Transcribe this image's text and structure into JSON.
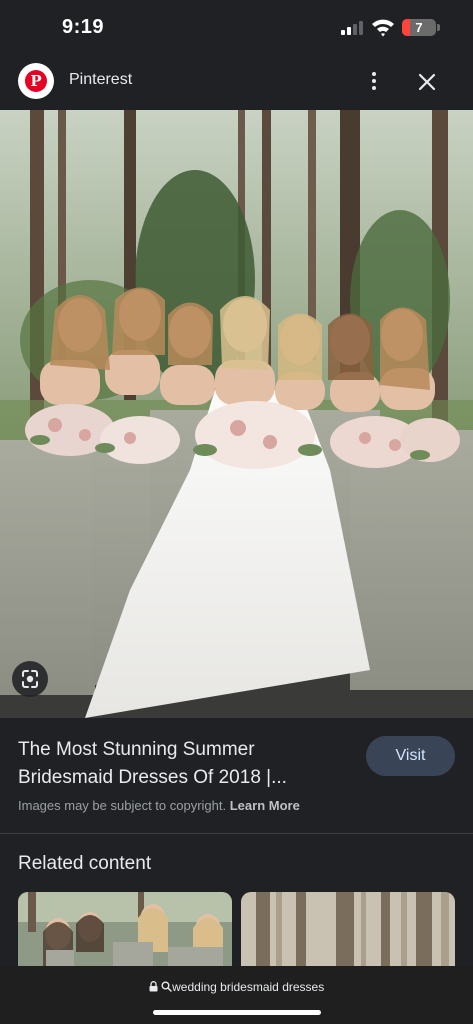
{
  "status_bar": {
    "time": "9:19",
    "battery_level": "7",
    "battery_color": "#ff453a"
  },
  "source": {
    "name": "Pinterest",
    "logo_icon": "pinterest-logo",
    "logo_color": "#e60023",
    "more_icon": "more-vert-icon",
    "close_icon": "close-icon"
  },
  "image": {
    "subject": "bride with bridesmaids holding bouquets in a forest",
    "lens_icon": "google-lens-icon"
  },
  "result": {
    "title": "The Most Stunning Summer Bridesmaid Dresses Of 2018 |...",
    "visit_label": "Visit",
    "copyright_text": "Images may be subject to copyright.",
    "learn_more_label": "Learn More"
  },
  "related": {
    "heading": "Related content"
  },
  "url_bar": {
    "lock_icon": "lock-icon",
    "search_icon": "search-icon",
    "query": "wedding bridesmaid dresses"
  }
}
